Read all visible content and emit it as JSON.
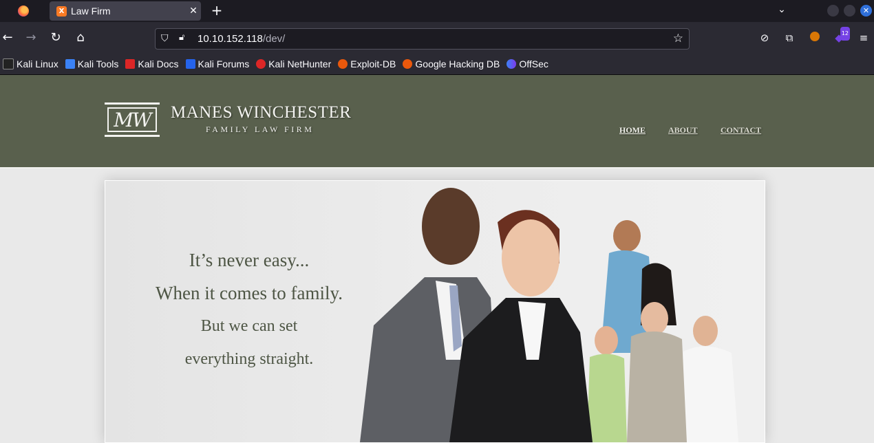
{
  "browser": {
    "tab_title": "Law Firm",
    "tab_favicon_letter": "X",
    "url_host": "10.10.152.118",
    "url_path": "/dev/",
    "extension_badge": "12",
    "bookmarks": [
      {
        "label": "Kali Linux",
        "color": "#3b3b3b"
      },
      {
        "label": "Kali Tools",
        "color": "#3b82f6"
      },
      {
        "label": "Kali Docs",
        "color": "#dc2626"
      },
      {
        "label": "Kali Forums",
        "color": "#2563eb"
      },
      {
        "label": "Kali NetHunter",
        "color": "#dc2626"
      },
      {
        "label": "Exploit-DB",
        "color": "#ea580c"
      },
      {
        "label": "Google Hacking DB",
        "color": "#ea580c"
      },
      {
        "label": "OffSec",
        "color": "#7c3aed"
      }
    ]
  },
  "site": {
    "logo_mark": "MW",
    "logo_title": "MANES WINCHESTER",
    "logo_subtitle": "FAMILY LAW FIRM",
    "nav": {
      "home": "HOME",
      "about": "ABOUT",
      "contact": "CONTACT"
    },
    "tagline": {
      "line1": "It’s never easy...",
      "line2": "When it comes to family.",
      "line3": "But we can set",
      "line4": "everything straight."
    },
    "colors": {
      "header_bg": "#59604d",
      "tagline": "#4d5544"
    }
  }
}
